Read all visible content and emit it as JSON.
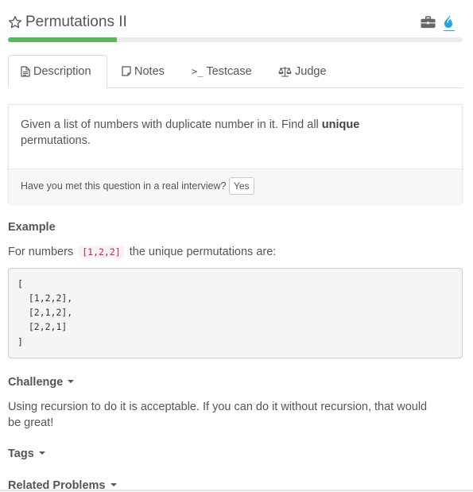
{
  "header": {
    "title": "Permutations II",
    "star_icon": "star-outline-icon",
    "briefcase_icon": "briefcase-icon",
    "flame_icon": "flame-icon",
    "progress_fraction": 0.24,
    "progress_color": "#5cb85c"
  },
  "tabs": [
    {
      "label": "Description",
      "icon": "file-text-icon",
      "active": true
    },
    {
      "label": "Notes",
      "icon": "note-icon",
      "active": false
    },
    {
      "label": "Testcase",
      "icon": "terminal-icon",
      "active": false
    },
    {
      "label": "Judge",
      "icon": "balance-scale-icon",
      "active": false
    }
  ],
  "description": {
    "text_before": "Given a list of numbers with duplicate number in it. Find all ",
    "bold": "unique",
    "text_after": "permutations."
  },
  "interview": {
    "question": "Have you met this question in a real interview?",
    "yes_label": "Yes"
  },
  "example": {
    "heading": "Example",
    "intro_before": "For numbers",
    "inline_code": "[1,2,2]",
    "intro_after": "the unique permutations are:",
    "code_lines": [
      "[",
      "  [1,2,2],",
      "  [2,1,2],",
      "  [2,2,1]",
      "]"
    ]
  },
  "challenge": {
    "heading": "Challenge",
    "line1": "Using recursion to do it is acceptable. If you can do it without recursion, that would",
    "line2": "be great!"
  },
  "tags": {
    "heading": "Tags"
  },
  "related": {
    "heading": "Related Problems"
  }
}
